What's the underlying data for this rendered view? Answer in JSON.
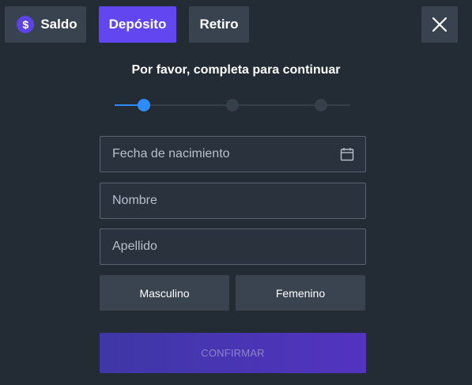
{
  "tabs": {
    "saldo": {
      "label": "Saldo",
      "icon": "dollar-coin-icon",
      "symbol": "$"
    },
    "deposito": {
      "label": "Depósito",
      "active": true
    },
    "retiro": {
      "label": "Retiro"
    }
  },
  "close_icon": "close-icon",
  "heading": "Por favor, completa para continuar",
  "stepper": {
    "current_step": 1,
    "total_steps": 3
  },
  "form": {
    "birthdate_placeholder": "Fecha de nacimiento",
    "birthdate_icon": "calendar-icon",
    "name_placeholder": "Nombre",
    "surname_placeholder": "Apellido"
  },
  "gender": {
    "male": "Masculino",
    "female": "Femenino"
  },
  "confirm_label": "CONFIRMAR",
  "colors": {
    "background": "#232b35",
    "accent": "#6246f0",
    "step_active": "#2d8cff",
    "confirm_gradient_start": "#3e37a6",
    "confirm_gradient_end": "#5333c0"
  }
}
